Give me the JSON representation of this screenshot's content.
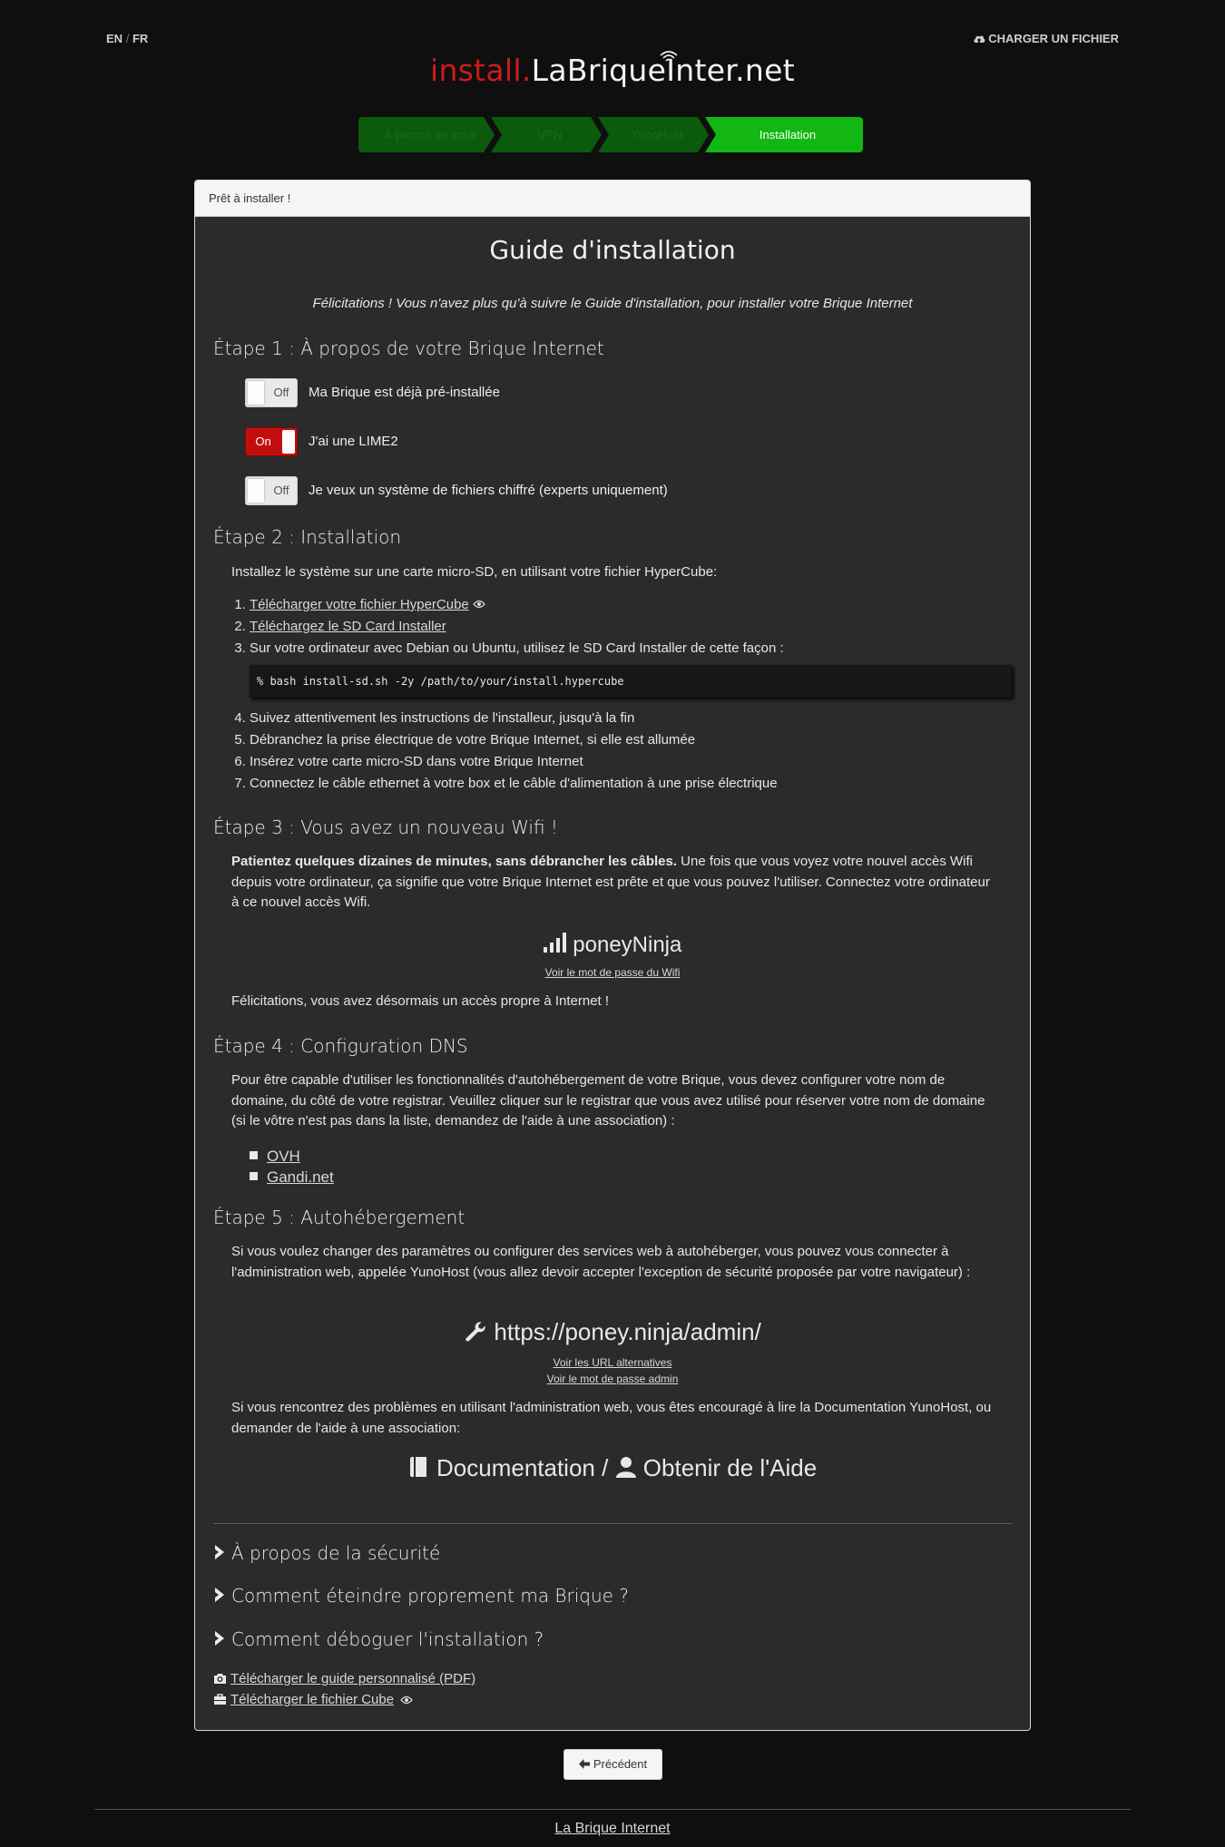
{
  "header": {
    "lang_en": "EN",
    "lang_sep": "/",
    "lang_fr": "FR",
    "upload_label": "Charger un fichier",
    "logo_red": "install.",
    "logo_white": "LaBriqueInter.net"
  },
  "wizard": {
    "steps": [
      "À propos de vous",
      "VPN",
      "YunoHost",
      "Installation"
    ],
    "active_index": 3
  },
  "panel": {
    "heading": "Prêt à installer !",
    "title": "Guide d'installation",
    "intro": "Félicitations ! Vous n'avez plus qu'à suivre le Guide d'installation, pour installer votre Brique Internet",
    "step1": {
      "title": "Étape 1 : À propos de votre Brique Internet",
      "toggles": [
        {
          "state": "Off",
          "label": "Ma Brique est déjà pré-installée"
        },
        {
          "state": "On",
          "label": "J'ai une LIME2"
        },
        {
          "state": "Off",
          "label": "Je veux un système de fichiers chiffré (experts uniquement)"
        }
      ]
    },
    "step2": {
      "title": "Étape 2 : Installation",
      "intro": "Installez le système sur une carte micro-SD, en utilisant votre fichier HyperCube:",
      "items": [
        "Télécharger votre fichier HyperCube",
        "Téléchargez le SD Card Installer",
        "Sur votre ordinateur avec Debian ou Ubuntu, utilisez le SD Card Installer de cette façon :"
      ],
      "command": "% bash install-sd.sh -2y /path/to/your/install.hypercube",
      "items_after": [
        "Suivez attentivement les instructions de l'installeur, jusqu'à la fin",
        "Débranchez la prise électrique de votre Brique Internet, si elle est allumée",
        "Insérez votre carte micro-SD dans votre Brique Internet",
        "Connectez le câble ethernet à votre box et le câble d'alimentation à une prise électrique"
      ]
    },
    "step3": {
      "title": "Étape 3 : Vous avez un nouveau Wifi !",
      "text_bold": "Patientez quelques dizaines de minutes, sans débrancher les câbles.",
      "text": " Une fois que vous voyez votre nouvel accès Wifi depuis votre ordinateur, ça signifie que votre Brique Internet est prête et que vous pouvez l'utiliser. Connectez votre ordinateur à ce nouvel accès Wifi.",
      "ssid": "poneyNinja",
      "password_link": "Voir le mot de passe du Wifi",
      "congrats": "Félicitations, vous avez désormais un accès propre à Internet !"
    },
    "step4": {
      "title": "Étape 4 : Configuration DNS",
      "text": "Pour être capable d'utiliser les fonctionnalités d'autohébergement de votre Brique, vous devez configurer votre nom de domaine, du côté de votre registrar. Veuillez cliquer sur le registrar que vous avez utilisé pour réserver votre nom de domaine (si le vôtre n'est pas dans la liste, demandez de l'aide à une association) :",
      "registrars": [
        "OVH",
        "Gandi.net"
      ]
    },
    "step5": {
      "title": "Étape 5 : Autohébergement",
      "text": "Si vous voulez changer des paramètres ou configurer des services web à autohéberger, vous pouvez vous connecter à l'administration web, appelée YunoHost (vous allez devoir accepter l'exception de sécurité proposée par votre navigateur) :",
      "admin_url": "https://poney.ninja/admin/",
      "alt_urls_link": "Voir les URL alternatives",
      "admin_pw_link": "Voir le mot de passe admin",
      "help_text": "Si vous rencontrez des problèmes en utilisant l'administration web, vous êtes encouragé à lire la Documentation YunoHost, ou demander de l'aide à une association:",
      "doc_label": "Documentation",
      "slash": " / ",
      "help_label": "Obtenir de l'Aide"
    },
    "faq": [
      "À propos de la sécurité",
      "Comment éteindre proprement ma Brique ?",
      "Comment déboguer l'installation ?"
    ],
    "downloads": {
      "guide": "Télécharger le guide personnalisé (PDF)",
      "cube": "Télécharger le fichier Cube"
    }
  },
  "nav": {
    "previous": "Précédent"
  },
  "footer": {
    "link": "La Brique Internet"
  },
  "colors": {
    "accent_red": "#cc1b1b",
    "active_green": "#13b713",
    "inactive_green": "#0c5a0c"
  }
}
